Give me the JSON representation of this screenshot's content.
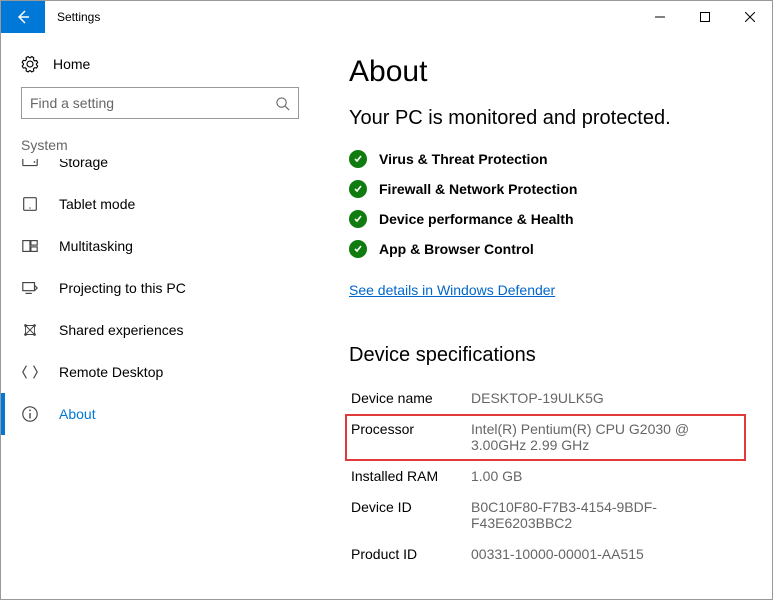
{
  "titlebar": {
    "title": "Settings"
  },
  "sidebar": {
    "home": "Home",
    "search_placeholder": "Find a setting",
    "category": "System",
    "items": [
      {
        "label": "Storage"
      },
      {
        "label": "Tablet mode"
      },
      {
        "label": "Multitasking"
      },
      {
        "label": "Projecting to this PC"
      },
      {
        "label": "Shared experiences"
      },
      {
        "label": "Remote Desktop"
      },
      {
        "label": "About"
      }
    ],
    "active_index": 6
  },
  "main": {
    "heading": "About",
    "security_sub": "Your PC is monitored and protected.",
    "security_items": [
      "Virus & Threat Protection",
      "Firewall & Network Protection",
      "Device performance & Health",
      "App & Browser Control"
    ],
    "defender_link": "See details in Windows Defender",
    "specs_heading": "Device specifications",
    "specs": [
      {
        "k": "Device name",
        "v": "DESKTOP-19ULK5G"
      },
      {
        "k": "Processor",
        "v": "Intel(R) Pentium(R) CPU G2030 @ 3.00GHz   2.99 GHz",
        "hl": true
      },
      {
        "k": "Installed RAM",
        "v": "1.00 GB"
      },
      {
        "k": "Device ID",
        "v": "B0C10F80-F7B3-4154-9BDF-F43E6203BBC2"
      },
      {
        "k": "Product ID",
        "v": "00331-10000-00001-AA515"
      }
    ]
  }
}
